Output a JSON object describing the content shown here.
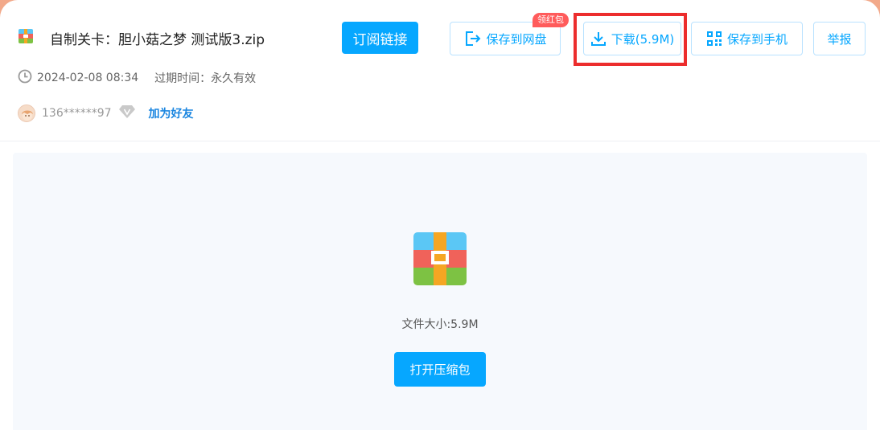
{
  "file": {
    "title": "自制关卡：胆小菇之梦 测试版3.zip",
    "icon": "zip-archive-icon"
  },
  "toolbar": {
    "subscribe_label": "订阅链接",
    "save_netdisk_label": "保存到网盘",
    "download_label": "下载(5.9M)",
    "save_phone_label": "保存到手机",
    "report_label": "举报",
    "badge_label": "领红包"
  },
  "meta": {
    "date": "2024-02-08 08:34",
    "expire_label": "过期时间：",
    "expire_value": "永久有效"
  },
  "user": {
    "name": "136******97",
    "add_friend_label": "加为好友"
  },
  "preview": {
    "file_size": "文件大小:5.9M",
    "open_label": "打开压缩包"
  },
  "colors": {
    "accent": "#06a7ff",
    "badge": "#ff5b5b",
    "highlight": "#ec2d2d",
    "background": "#f2a98a"
  }
}
